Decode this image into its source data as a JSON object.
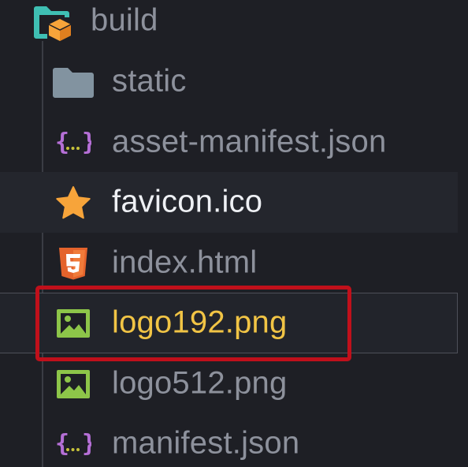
{
  "tree": {
    "items": [
      {
        "label": "build",
        "icon": "folder-open-build-icon"
      },
      {
        "label": "static",
        "icon": "folder-icon"
      },
      {
        "label": "asset-manifest.json",
        "icon": "json-file-icon"
      },
      {
        "label": "favicon.ico",
        "icon": "star-icon"
      },
      {
        "label": "index.html",
        "icon": "html5-icon"
      },
      {
        "label": "logo192.png",
        "icon": "image-file-icon"
      },
      {
        "label": "logo512.png",
        "icon": "image-file-icon"
      },
      {
        "label": "manifest.json",
        "icon": "json-file-icon"
      }
    ]
  },
  "colors": {
    "background": "#1e1f25",
    "label": "#8d919c",
    "hover_label": "#eef0f4",
    "selected_label": "#f1c445",
    "highlight_box": "#c0101b",
    "image_icon": "#8dc549",
    "json_brace": "#b56fd6",
    "html5_icon": "#e4632c",
    "star_icon": "#f7a43a",
    "folder_icon": "#8293a0"
  },
  "state": {
    "hovered": "favicon.ico",
    "selected": "logo192.png"
  }
}
